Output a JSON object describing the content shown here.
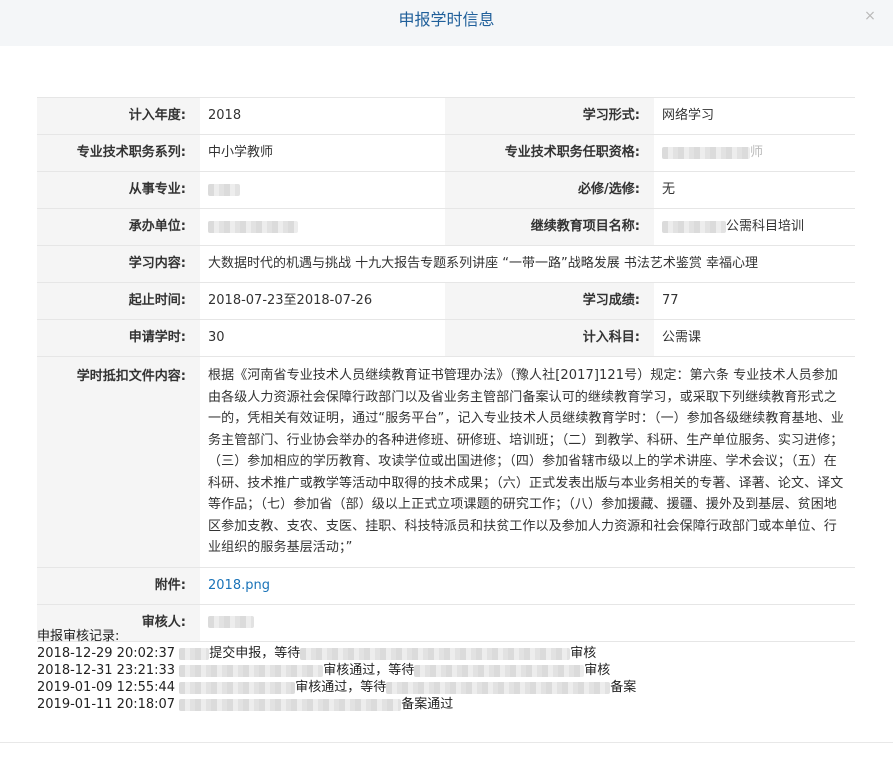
{
  "header": {
    "title": "申报学时信息",
    "close_glyph": "×"
  },
  "fields": {
    "year_label": "计入年度:",
    "year_value": "2018",
    "study_form_label": "学习形式:",
    "study_form_value": "网络学习",
    "job_series_label": "专业技术职务系列:",
    "job_series_value": "中小学教师",
    "job_qualification_label": "专业技术职务任职资格:",
    "job_qualification_suffix": "师",
    "major_label": "从事专业:",
    "required_label": "必修/选修:",
    "required_value": "无",
    "organizer_label": "承办单位:",
    "project_label": "继续教育项目名称:",
    "project_suffix": "公需科目培训",
    "content_label": "学习内容:",
    "content_value": "大数据时代的机遇与挑战 十九大报告专题系列讲座 “一带一路”战略发展 书法艺术鉴赏 幸福心理",
    "period_label": "起止时间:",
    "period_value": "2018-07-23至2018-07-26",
    "score_label": "学习成绩:",
    "score_value": "77",
    "hours_label": "申请学时:",
    "hours_value": "30",
    "subject_label": "计入科目:",
    "subject_value": "公需课",
    "doc_label": "学时抵扣文件内容:",
    "doc_value": "根据《河南省专业技术人员继续教育证书管理办法》（豫人社[2017]121号）规定：第六条 专业技术人员参加由各级人力资源社会保障行政部门以及省业务主管部门备案认可的继续教育学习，或采取下列继续教育形式之一的，凭相关有效证明，通过“服务平台”，记入专业技术人员继续教育学时：（一）参加各级继续教育基地、业务主管部门、行业协会举办的各种进修班、研修班、培训班；（二）到教学、科研、生产单位服务、实习进修；（三）参加相应的学历教育、攻读学位或出国进修；（四）参加省辖市级以上的学术讲座、学术会议；（五）在科研、技术推广或教学等活动中取得的技术成果；（六）正式发表出版与本业务相关的专著、译著、论文、译文等作品；（七）参加省（部）级以上正式立项课题的研究工作；（八）参加援藏、援疆、援外及到基层、贫困地区参加支教、支农、支医、挂职、科技特派员和扶贫工作以及参加人力资源和社会保障行政部门或本单位、行业组织的服务基层活动；”",
    "attachment_label": "附件:",
    "attachment_value": "2018.png",
    "reviewer_label": "审核人:"
  },
  "log": {
    "title": "申报审核记录:",
    "entries": [
      {
        "time": "2018-12-29 20:02:37",
        "text_a": "提交申报，等待",
        "text_b": "审核"
      },
      {
        "time": "2018-12-31 23:21:33",
        "text_a": "审核通过，等待",
        "text_b": "审核"
      },
      {
        "time": "2019-01-09 12:55:44",
        "text_a": "审核通过，等待",
        "text_b": "备案"
      },
      {
        "time": "2019-01-11 20:18:07",
        "text_a": "备案通过",
        "text_b": ""
      }
    ]
  },
  "colors": {
    "title": "#1f5f9a",
    "link": "#1a73b8",
    "label_bg": "#f5f5f5",
    "header_bg": "#f4f6f8"
  }
}
